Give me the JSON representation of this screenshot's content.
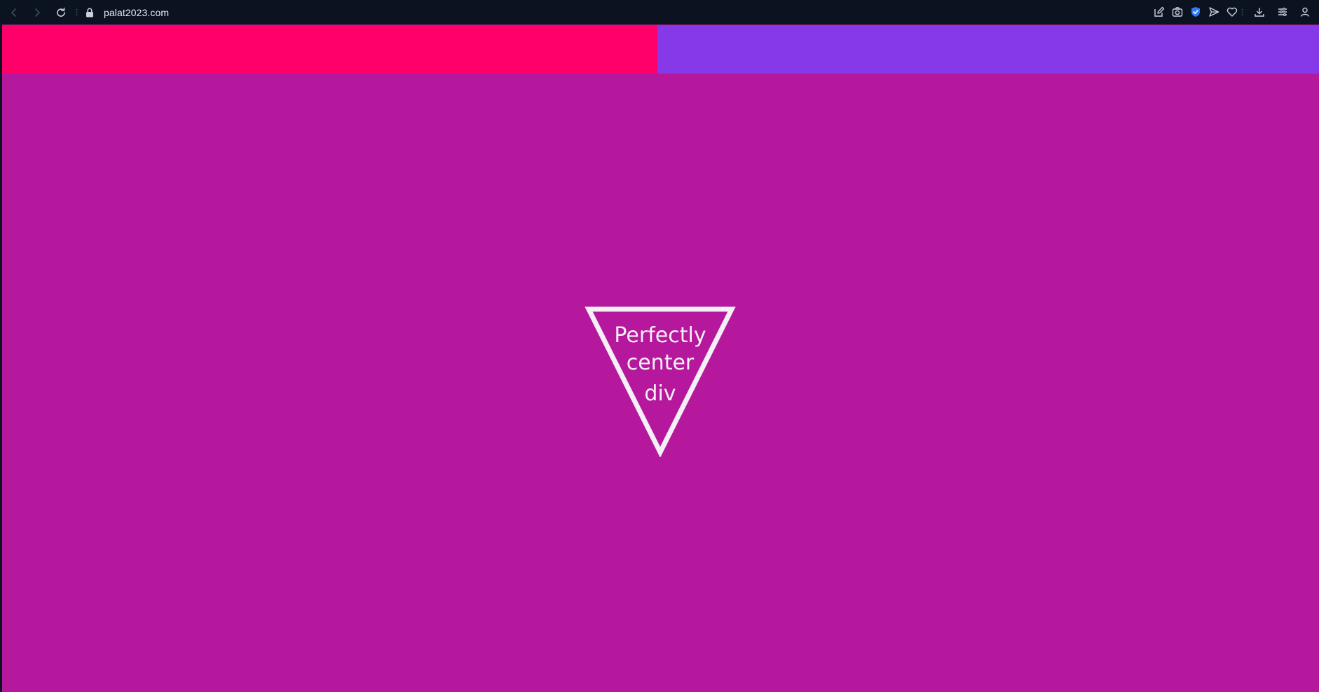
{
  "browser": {
    "url": "palat2023.com",
    "icons": {
      "back": "back-arrow-icon",
      "forward": "forward-arrow-icon",
      "reload": "reload-icon",
      "lock": "lock-icon",
      "toolbar": [
        "edit-icon",
        "camera-icon",
        "shield-icon",
        "send-icon",
        "heart-icon",
        "download-icon",
        "menu-icon",
        "user-icon"
      ]
    }
  },
  "page": {
    "background_color": "#b5189d",
    "band_left_color": "#ff006b",
    "band_right_color": "#8539e8",
    "triangle_text": {
      "line1": "Perfectly",
      "line2": "center",
      "line3": "div"
    }
  }
}
